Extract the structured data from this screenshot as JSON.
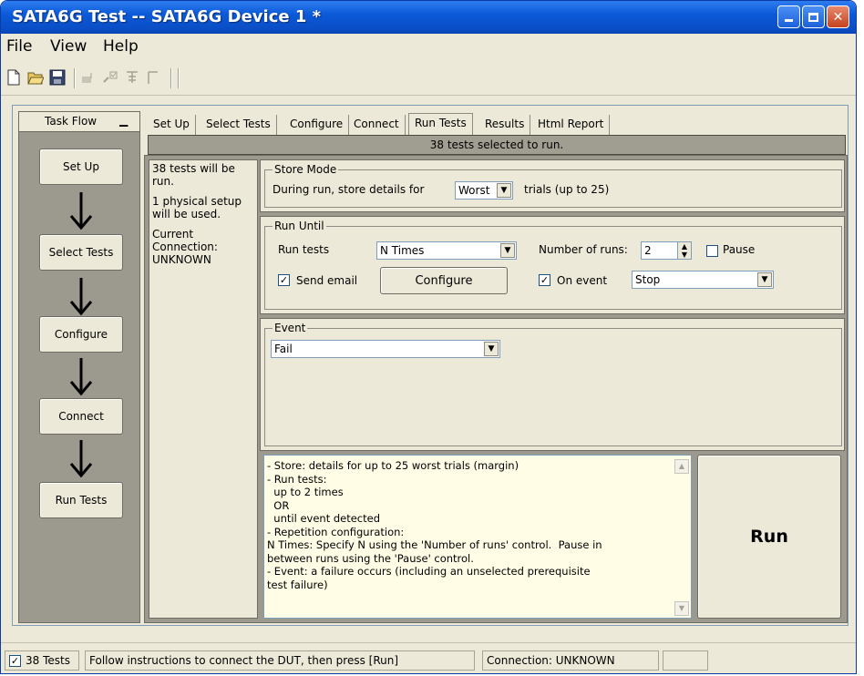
{
  "window": {
    "title": "SATA6G Test -- SATA6G Device 1 *"
  },
  "menu": [
    "File",
    "View",
    "Help"
  ],
  "toolbar": {
    "icons": [
      "new-icon",
      "open-icon",
      "save-icon",
      "step-icon",
      "run-selected-icon",
      "stop-icon",
      "bar-icon"
    ]
  },
  "taskflow": {
    "title": "Task Flow",
    "steps": [
      "Set Up",
      "Select Tests",
      "Configure",
      "Connect",
      "Run Tests"
    ]
  },
  "tabs": [
    "Set Up",
    "Select Tests",
    "Configure",
    "Connect",
    "Run Tests",
    "Results",
    "Html Report"
  ],
  "active_tab": "Run Tests",
  "status_strip": "38 tests selected to run.",
  "info": {
    "line1": "38 tests will be run.",
    "line2": "1 physical setup will be used.",
    "line3a": "Current",
    "line3b": "Connection:",
    "line3c": "UNKNOWN"
  },
  "store_mode": {
    "legend": "Store Mode",
    "label_before": "During run, store details for",
    "value": "Worst",
    "label_after": "trials (up to 25)"
  },
  "run_until": {
    "legend": "Run Until",
    "run_tests_label": "Run tests",
    "run_tests_value": "N Times",
    "num_runs_label": "Number of runs:",
    "num_runs_value": "2",
    "pause_label": "Pause",
    "pause_checked": false,
    "send_email_label": "Send email",
    "send_email_checked": true,
    "configure_label": "Configure",
    "on_event_label": "On event",
    "on_event_checked": true,
    "on_event_value": "Stop"
  },
  "event": {
    "legend": "Event",
    "value": "Fail"
  },
  "description": [
    "- Store: details for up to 25 worst trials (margin)",
    "- Run tests:",
    "  up to 2 times",
    "  OR",
    "  until event detected",
    "- Repetition configuration:",
    "N Times: Specify N using the 'Number of runs' control.  Pause in",
    "between runs using the 'Pause' control.",
    "- Event: a failure occurs (including an unselected prerequisite",
    "test failure)"
  ],
  "run_button": "Run",
  "statusbar": {
    "tests": "38 Tests",
    "tests_checked": true,
    "message": "Follow instructions to connect the DUT, then press [Run]",
    "connection": "Connection: UNKNOWN"
  }
}
